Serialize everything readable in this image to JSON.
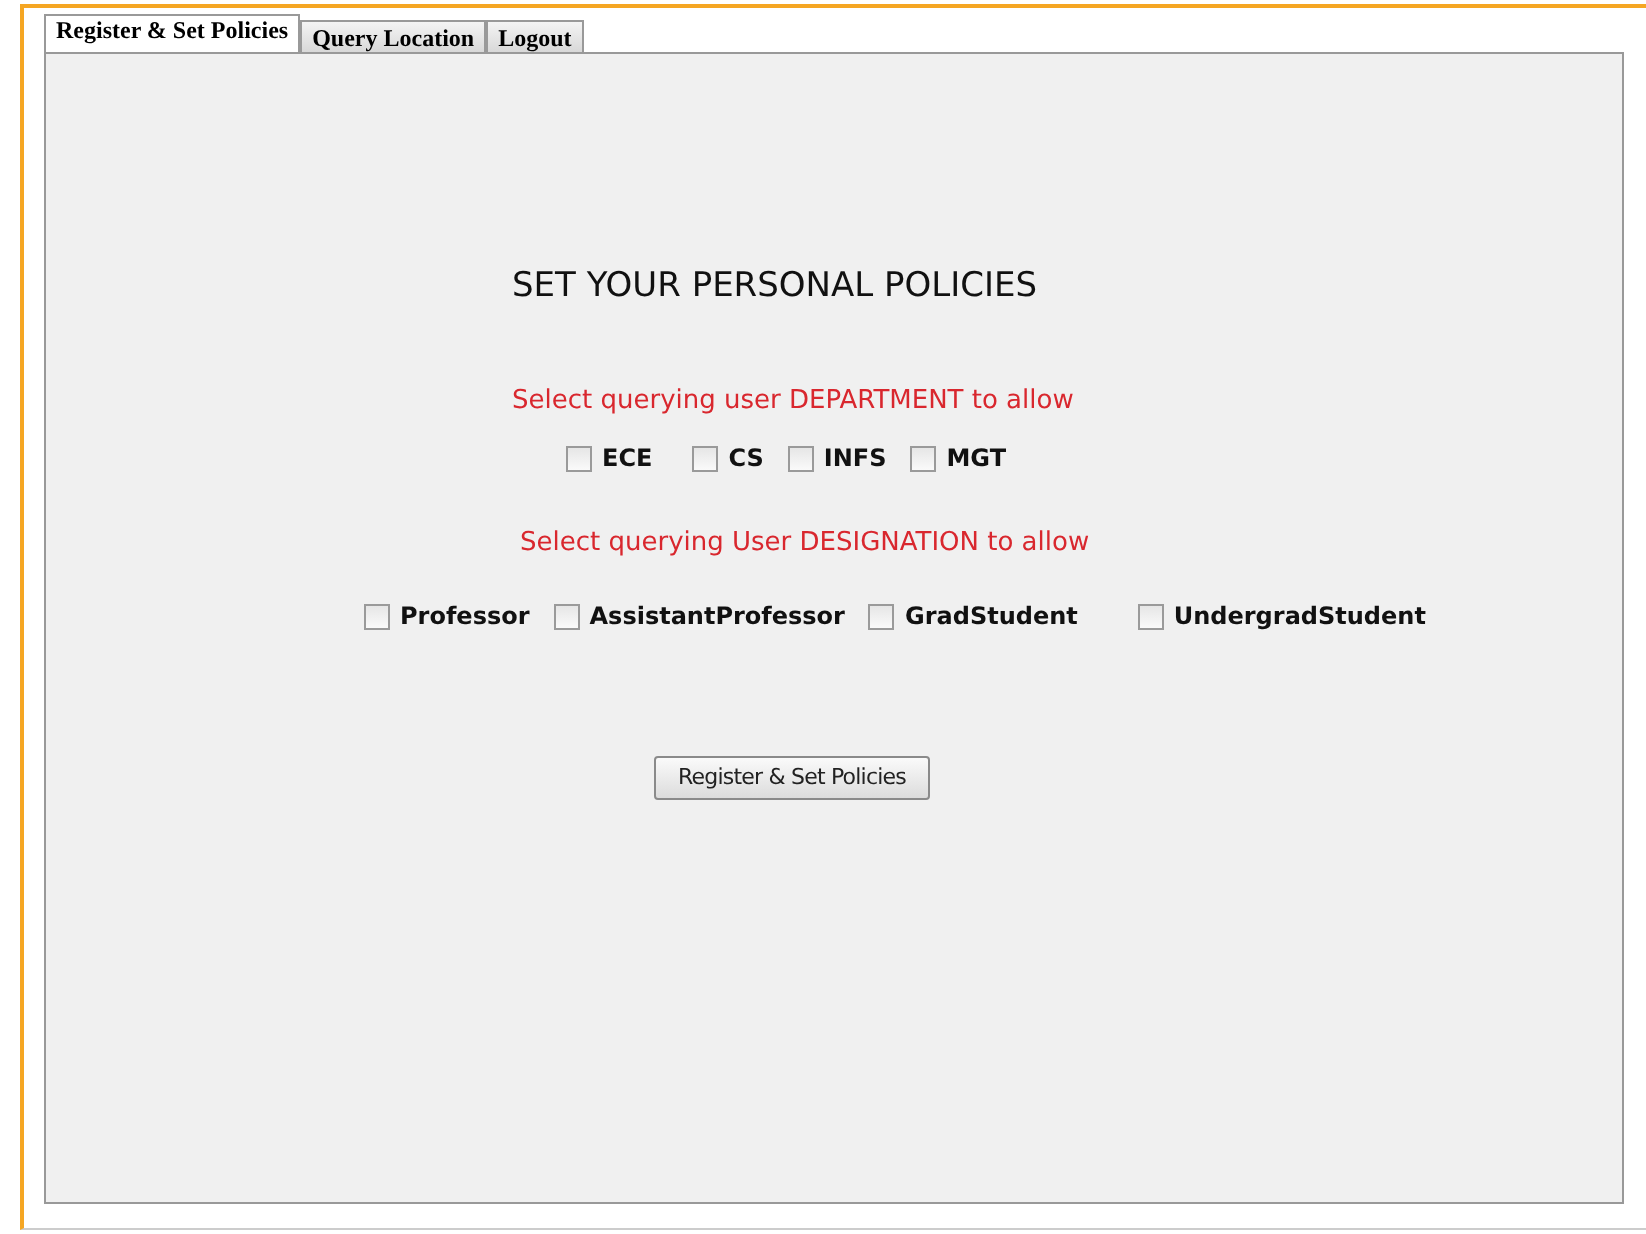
{
  "tabs": [
    {
      "label": "Register & Set Policies",
      "selected": true
    },
    {
      "label": "Query Location",
      "selected": false
    },
    {
      "label": "Logout",
      "selected": false
    }
  ],
  "heading": "SET YOUR PERSONAL POLICIES",
  "department": {
    "prompt": "Select querying user DEPARTMENT to allow",
    "options": [
      {
        "label": "ECE",
        "checked": false
      },
      {
        "label": "CS",
        "checked": false
      },
      {
        "label": "INFS",
        "checked": false
      },
      {
        "label": "MGT",
        "checked": false
      }
    ]
  },
  "designation": {
    "prompt": "Select querying User DESIGNATION to allow",
    "options": [
      {
        "label": "Professor",
        "checked": false
      },
      {
        "label": "AssistantProfessor",
        "checked": false
      },
      {
        "label": "GradStudent",
        "checked": false
      },
      {
        "label": "UndergradStudent",
        "checked": false
      }
    ]
  },
  "submit": "Register & Set Policies"
}
